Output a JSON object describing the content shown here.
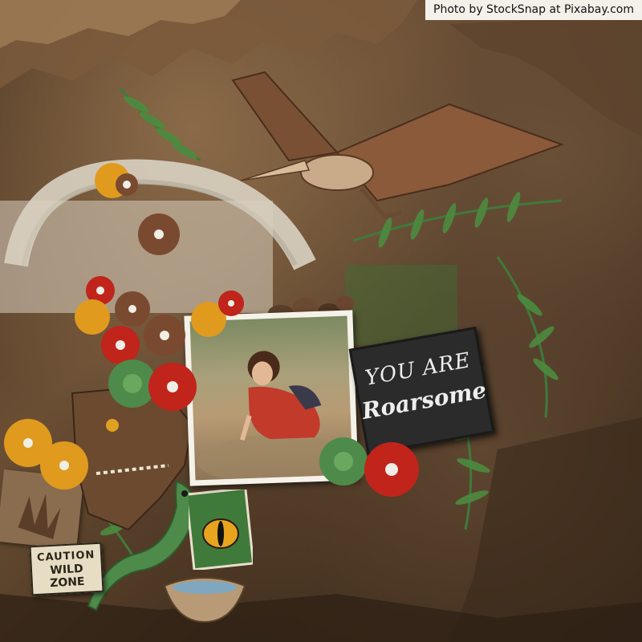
{
  "credit": {
    "text": "Photo by StockSnap at Pixabay.com"
  },
  "sign": {
    "line1": "YOU ARE",
    "line2": "Roarsome"
  },
  "caution_sign": {
    "line1": "CAUTION",
    "line2": "WILD",
    "line3": "ZONE"
  },
  "colors": {
    "background": "#4a3522",
    "fern": "#3f7a3a",
    "flower_red": "#c0241b",
    "flower_orange": "#e09a1e",
    "flower_brown": "#7a4a30",
    "chalkboard": "#2b2b2b"
  },
  "icons": [
    "pterodactyl-icon",
    "t-rex-icon",
    "dinosaur-eye-icon",
    "baby-dinosaur-icon",
    "fern-icon",
    "flower-icon",
    "footprint-icon"
  ]
}
